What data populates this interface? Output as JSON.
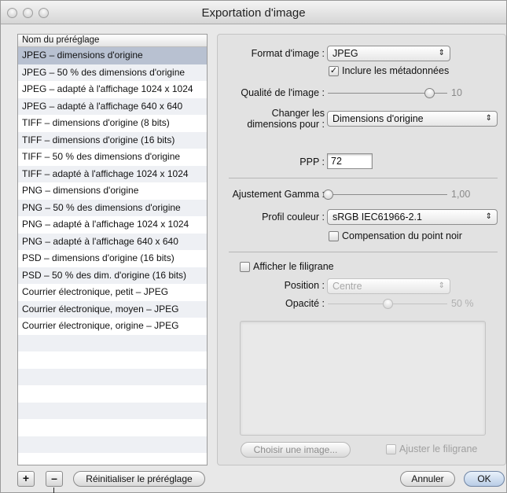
{
  "window": {
    "title": "Exportation d'image"
  },
  "presets": {
    "header": "Nom du préréglage",
    "items": [
      "JPEG – dimensions d'origine",
      "JPEG – 50 % des dimensions d'origine",
      "JPEG – adapté à l'affichage 1024 x 1024",
      "JPEG – adapté à l'affichage 640 x 640",
      "TIFF – dimensions d'origine (8 bits)",
      "TIFF – dimensions d'origine (16 bits)",
      "TIFF – 50 % des dimensions d'origine",
      "TIFF – adapté à l'affichage 1024 x 1024",
      "PNG – dimensions d'origine",
      "PNG – 50 % des dimensions d'origine",
      "PNG – adapté à l'affichage 1024 x 1024",
      "PNG – adapté à l'affichage 640 x 640",
      "PSD – dimensions d'origine (16 bits)",
      "PSD – 50 % des dim. d'origine (16 bits)",
      "Courrier électronique, petit – JPEG",
      "Courrier électronique, moyen – JPEG",
      "Courrier électronique, origine – JPEG"
    ],
    "selected_index": 0,
    "add_label": "+",
    "remove_label": "–",
    "reset_label": "Réinitialiser le préréglage"
  },
  "settings": {
    "format_label": "Format d'image :",
    "format_value": "JPEG",
    "metadata_label": "Inclure les métadonnées",
    "metadata_checked": true,
    "quality_label": "Qualité de l'image :",
    "quality_value": "10",
    "quality_level": 0.85,
    "resize_label_1": "Changer les",
    "resize_label_2": "dimensions pour :",
    "resize_value": "Dimensions d'origine",
    "ppp_label": "PPP :",
    "ppp_value": "72",
    "gamma_label": "Ajustement Gamma :",
    "gamma_value": "1,00",
    "gamma_level": 0.0,
    "profile_label": "Profil couleur :",
    "profile_value": "sRGB IEC61966-2.1",
    "blackpoint_label": "Compensation du point noir",
    "blackpoint_checked": false,
    "watermark_label": "Afficher le filigrane",
    "watermark_checked": false,
    "position_label": "Position :",
    "position_value": "Centre",
    "opacity_label": "Opacité :",
    "opacity_value": "50 %",
    "opacity_level": 0.5,
    "choose_image_label": "Choisir une image...",
    "fit_watermark_label": "Ajuster le filigrane",
    "fit_watermark_checked": false
  },
  "footer": {
    "cancel_label": "Annuler",
    "ok_label": "OK"
  },
  "icons": {
    "popup_arrows": "updown-arrows-icon",
    "check": "checkmark-icon"
  },
  "colors": {
    "selected_row": "#b8c1d1",
    "alt_row": "#eef0f4",
    "ok_button": "#cfe0f3"
  }
}
